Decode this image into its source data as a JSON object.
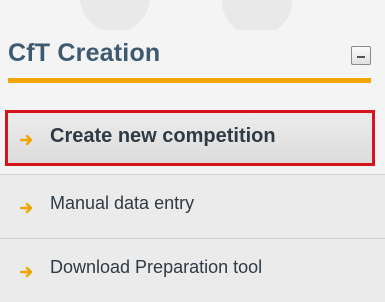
{
  "panel": {
    "title": "CfT Creation",
    "collapse_icon": "minus-icon"
  },
  "colors": {
    "title": "#3d5a73",
    "accent_rule": "#f0a500",
    "arrow": "#f0a500",
    "selection_border": "#d6141b"
  },
  "menu": {
    "items": [
      {
        "label": "Create new competition",
        "icon": "arrow-right-icon",
        "selected": true
      },
      {
        "label": "Manual data entry",
        "icon": "arrow-right-icon",
        "selected": false
      },
      {
        "label": "Download Preparation tool",
        "icon": "arrow-right-icon",
        "selected": false
      }
    ]
  }
}
